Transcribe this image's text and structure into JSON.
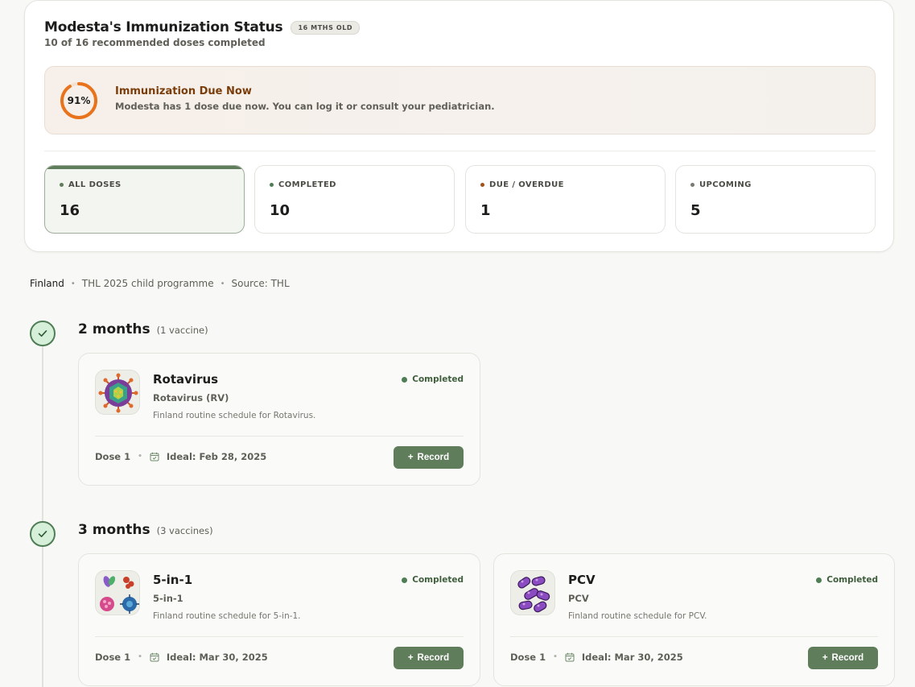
{
  "summary": {
    "title": "Modesta's Immunization Status",
    "age_badge": "16 MTHS OLD",
    "subtitle": "10 of 16 recommended doses completed"
  },
  "due_banner": {
    "progress_percent": 91,
    "progress_label": "91%",
    "title": "Immunization Due Now",
    "text": "Modesta has 1 dose due now. You can log it or consult your pediatrician.",
    "ring_color": "#e8731c"
  },
  "stats": [
    {
      "label": "ALL DOSES",
      "value": "16",
      "dot_color": "#5f7c5b"
    },
    {
      "label": "COMPLETED",
      "value": "10",
      "dot_color": "#4f7d55"
    },
    {
      "label": "DUE / OVERDUE",
      "value": "1",
      "dot_color": "#a0521c"
    },
    {
      "label": "UPCOMING",
      "value": "5",
      "dot_color": "#7a7a74"
    }
  ],
  "source": {
    "country": "Finland",
    "programme": "THL 2025 child programme",
    "source": "Source: THL"
  },
  "groups": [
    {
      "title": "2 months",
      "count": "(1 vaccine)",
      "vaccines": [
        {
          "name": "Rotavirus",
          "subname": "Rotavirus (RV)",
          "description": "Finland routine schedule for Rotavirus.",
          "status": "Completed",
          "dose": "Dose 1",
          "ideal": "Ideal: Feb 28, 2025",
          "action": "Record",
          "icon": "rotavirus-icon"
        }
      ]
    },
    {
      "title": "3 months",
      "count": "(3 vaccines)",
      "vaccines": [
        {
          "name": "5-in-1",
          "subname": "5-in-1",
          "description": "Finland routine schedule for 5-in-1.",
          "status": "Completed",
          "dose": "Dose 1",
          "ideal": "Ideal: Mar 30, 2025",
          "action": "Record",
          "icon": "combo-vaccine-icon"
        },
        {
          "name": "PCV",
          "subname": "PCV",
          "description": "Finland routine schedule for PCV.",
          "status": "Completed",
          "dose": "Dose 1",
          "ideal": "Ideal: Mar 30, 2025",
          "action": "Record",
          "icon": "pneumococcus-icon"
        }
      ]
    }
  ],
  "colors": {
    "accent": "#5f7c5b",
    "completed": "#4f7d55",
    "due": "#7a3d0a"
  }
}
